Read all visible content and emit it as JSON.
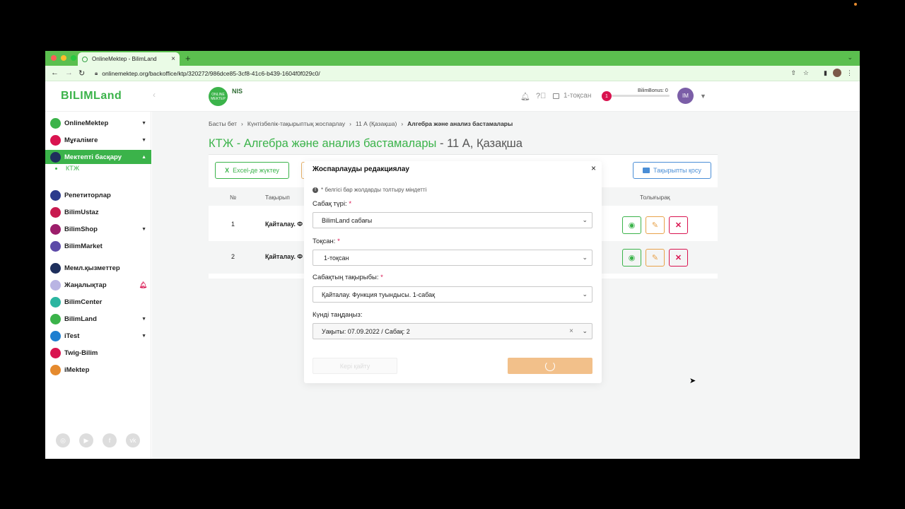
{
  "browser": {
    "tab_title": "OnlineMektep - BilimLand",
    "tab_close": "×",
    "new_tab": "+",
    "url": "onlinemektep.org/backoffice/ktp/320272/986dce85-3cf8-41c6-b439-1604f0f029c0/",
    "colors": {
      "chrome": "#5bbf4f",
      "tab": "#eafbe6"
    }
  },
  "header": {
    "logo": "BILIMLand",
    "online_logo": "ONLINE MEKTEP",
    "nis_logo": "NIS",
    "quarter": "1-тоқсан",
    "bonus_badge": "1",
    "bonus_label": "BilimBonus: 0",
    "user_initials": "IM"
  },
  "sidebar": {
    "items": [
      {
        "label": "OnlineMektep",
        "icon": "onlinemektep-icon",
        "color": "#3bb34a",
        "has_chevron": true
      },
      {
        "label": "Мұғалімге",
        "icon": "teacher-icon",
        "color": "#d9134f",
        "has_chevron": true
      },
      {
        "label": "Мектепті басқару",
        "icon": "school-manage-icon",
        "color": "#1e2f5c",
        "has_chevron": true,
        "active": true
      },
      {
        "label": "Репетиторлар",
        "icon": "tutors-icon",
        "color": "#2b3a8c"
      },
      {
        "label": "BilimUstaz",
        "icon": "bilimustaz-icon",
        "color": "#c8194f"
      },
      {
        "label": "BilimShop",
        "icon": "bilimshop-icon",
        "color": "#9c1d6b",
        "has_chevron": true
      },
      {
        "label": "BilimMarket",
        "icon": "bilimmarket-icon",
        "color": "#5d4aa8"
      },
      {
        "label": "Мемл.қызметтер",
        "icon": "gov-services-icon",
        "color": "#1e2f5c"
      },
      {
        "label": "Жаңалықтар",
        "icon": "news-icon",
        "color": "#b9b4e3"
      },
      {
        "label": "BilimCenter",
        "icon": "bilimcenter-icon",
        "color": "#2bb5a0"
      },
      {
        "label": "BilimLand",
        "icon": "bilimland-icon",
        "color": "#3bb34a",
        "has_chevron": true
      },
      {
        "label": "iTest",
        "icon": "itest-icon",
        "color": "#1e7fd0",
        "has_chevron": true
      },
      {
        "label": "Twig-Bilim",
        "icon": "twig-icon",
        "color": "#d9134f"
      },
      {
        "label": "iMektep",
        "icon": "imektep-icon",
        "color": "#e58a2e"
      }
    ],
    "sub_item": "КТЖ"
  },
  "breadcrumb": {
    "home": "Басты бет",
    "plan": "Күнтізбелік-тақырыптық жоспарлау",
    "class": "11 А (Қазақша)",
    "current": "Алгебра және анализ бастамалары"
  },
  "page": {
    "title_main": "КТЖ - Алгебра және анализ бастамалары",
    "title_sub": " - 11 А, Қазақша",
    "excel_button": "Excel-де жүктеу",
    "add_topic_button": "Тақырыпты қосу"
  },
  "table": {
    "headers": {
      "num": "№",
      "topic": "Тақырып",
      "more": "Толығырақ"
    },
    "rows": [
      {
        "num": "1",
        "topic": "Қайталау. Ф"
      },
      {
        "num": "2",
        "topic": "Қайталау. Ф"
      }
    ]
  },
  "modal": {
    "title": "Жоспарлауды редакциялау",
    "close": "×",
    "note": "* белгісі бар жолдарды толтыру міндетті",
    "lesson_type_label": "Сабақ түрі:",
    "lesson_type_value": "BilimLand сабағы",
    "quarter_label": "Тоқсан:",
    "quarter_value": "1-тоқсан",
    "topic_label": "Сабақтың тақырыбы:",
    "topic_value": "Қайталау. Функция туындысы. 1-сабақ",
    "date_label": "Күнді таңдаңыз:",
    "date_value": "Уақыты: 07.09.2022 / Сабақ: 2",
    "required_mark": "*",
    "back_button": "Кері қайту"
  }
}
